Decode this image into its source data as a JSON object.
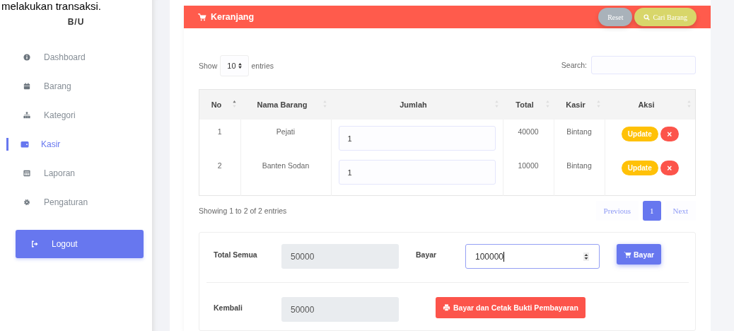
{
  "page_caption": "melakukan transaksi.",
  "sidebar": {
    "brand": "B/U",
    "items": [
      {
        "label": "Dashboard",
        "selected": false
      },
      {
        "label": "Barang",
        "selected": false
      },
      {
        "label": "Kategori",
        "selected": false
      },
      {
        "label": "Kasir",
        "selected": true
      },
      {
        "label": "Laporan",
        "selected": false
      },
      {
        "label": "Pengaturan",
        "selected": false
      }
    ],
    "logout": "Logout"
  },
  "cart": {
    "title": "Keranjang",
    "buttons": [
      {
        "label": "Reset",
        "kind": "reset"
      },
      {
        "label": "Cari Barang",
        "kind": "search"
      }
    ]
  },
  "table_controls": {
    "show": "Show",
    "page_size": "10",
    "entries": "entries",
    "search_label": "Search:"
  },
  "table": {
    "columns": [
      {
        "label": "No",
        "sorted": true
      },
      {
        "label": "Nama Barang",
        "sorted": false
      },
      {
        "label": "Jumlah",
        "sorted": false
      },
      {
        "label": "Total",
        "sorted": false
      },
      {
        "label": "Kasir",
        "sorted": false
      },
      {
        "label": "Aksi",
        "sorted": false
      }
    ],
    "rows": [
      {
        "no": "1",
        "name": "Pejati",
        "qty": "1",
        "total": "40000",
        "cashier": "Bintang",
        "update": "Update",
        "delete": "×"
      },
      {
        "no": "2",
        "name": "Banten Sodan",
        "qty": "1",
        "total": "10000",
        "cashier": "Bintang",
        "update": "Update",
        "delete": "×"
      }
    ]
  },
  "table_info": "Showing 1 to 2 of 2 entries",
  "pagination": [
    {
      "label": "Previous",
      "selected": false
    },
    {
      "label": "1",
      "selected": true
    },
    {
      "label": "Next",
      "selected": false
    }
  ],
  "payment": {
    "total_label": "Total Semua",
    "total": "50000",
    "pay_label": "Bayar",
    "pay": "100000",
    "pay_button": "Bayar",
    "change_label": "Kembali",
    "change": "50000",
    "print_button": "Bayar dan Cetak Bukti Pembayaran"
  }
}
